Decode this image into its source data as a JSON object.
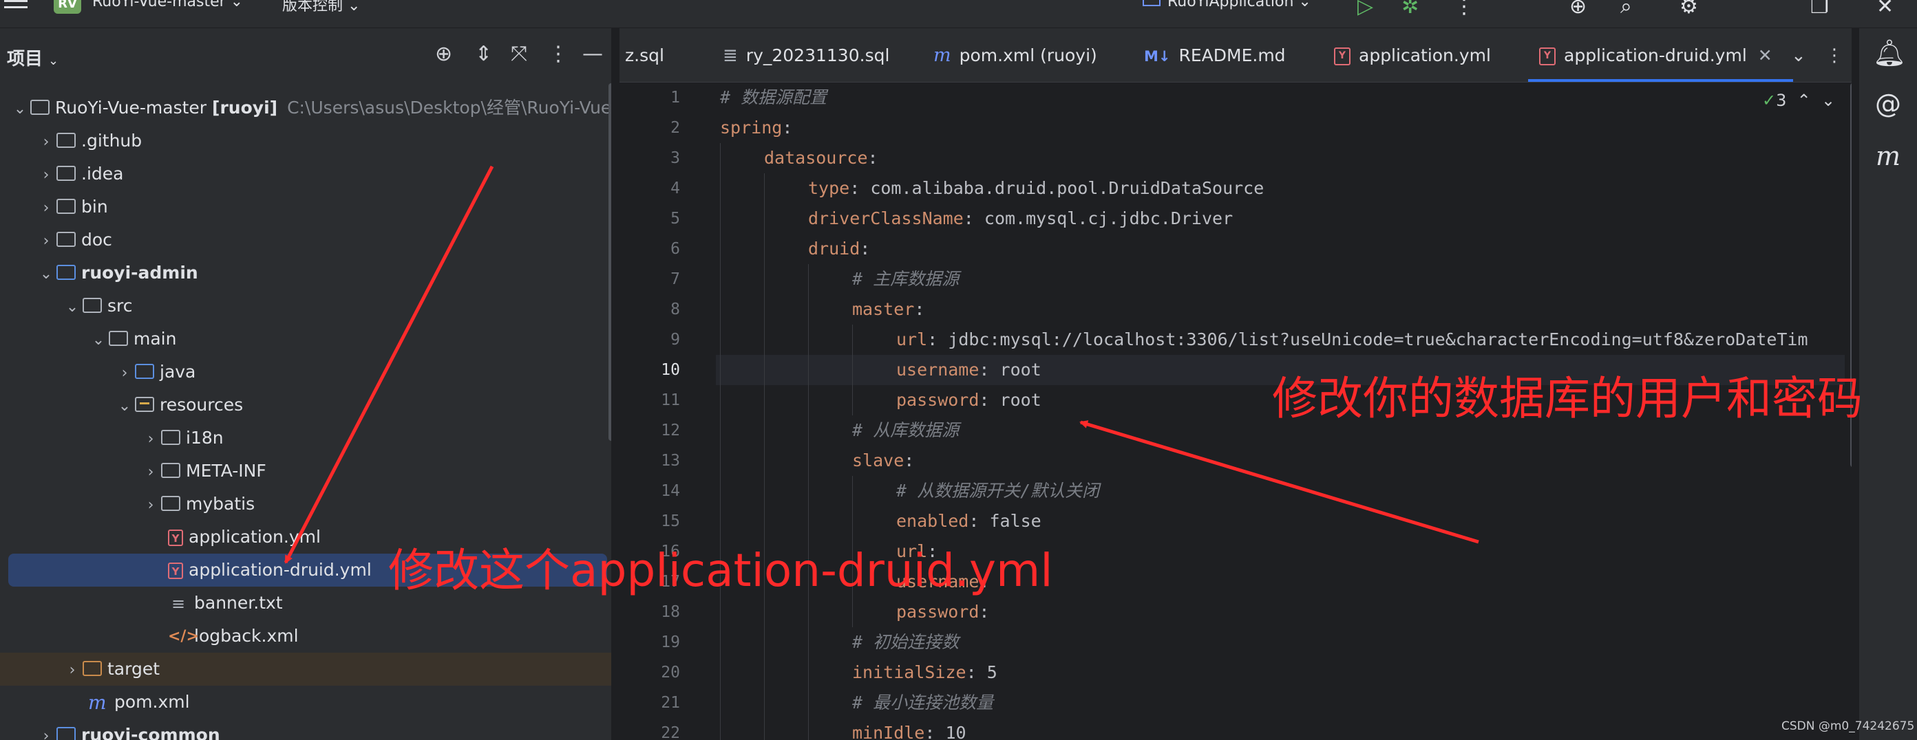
{
  "titlebar": {
    "project_badge": "RV",
    "project_name": "RuoYi-Vue-master",
    "vcs": "版本控制",
    "run_config": "RuoYiApplication"
  },
  "sidebar": {
    "title": "项目",
    "tree": [
      {
        "label": "RuoYi-Vue-master",
        "module": "[ruoyi]",
        "path": "C:\\Users\\asus\\Desktop\\经管\\RuoYi-Vue-mas"
      },
      {
        "label": ".github"
      },
      {
        "label": ".idea"
      },
      {
        "label": "bin"
      },
      {
        "label": "doc"
      },
      {
        "label": "ruoyi-admin"
      },
      {
        "label": "src"
      },
      {
        "label": "main"
      },
      {
        "label": "java"
      },
      {
        "label": "resources"
      },
      {
        "label": "i18n"
      },
      {
        "label": "META-INF"
      },
      {
        "label": "mybatis"
      },
      {
        "label": "application.yml"
      },
      {
        "label": "application-druid.yml"
      },
      {
        "label": "banner.txt"
      },
      {
        "label": "logback.xml"
      },
      {
        "label": "target"
      },
      {
        "label": "pom.xml"
      },
      {
        "label": "ruoyi-common"
      }
    ]
  },
  "tabs": [
    {
      "label": "z.sql"
    },
    {
      "label": "ry_20231130.sql"
    },
    {
      "label": "pom.xml (ruoyi)"
    },
    {
      "label": "README.md"
    },
    {
      "label": "application.yml"
    },
    {
      "label": "application-druid.yml"
    }
  ],
  "editor": {
    "inspection_count": "3",
    "current_line": 10,
    "lines": [
      {
        "n": "1",
        "comment": "# 数据源配置"
      },
      {
        "n": "2",
        "key": "spring",
        "value": ""
      },
      {
        "n": "3",
        "key": "datasource",
        "value": ""
      },
      {
        "n": "4",
        "key": "type",
        "value": " com.alibaba.druid.pool.DruidDataSource"
      },
      {
        "n": "5",
        "key": "driverClassName",
        "value": " com.mysql.cj.jdbc.Driver"
      },
      {
        "n": "6",
        "key": "druid",
        "value": ""
      },
      {
        "n": "7",
        "comment": "# 主库数据源"
      },
      {
        "n": "8",
        "key": "master",
        "value": ""
      },
      {
        "n": "9",
        "key": "url",
        "value": " jdbc:mysql://localhost:3306/list?useUnicode=true&characterEncoding=utf8&zeroDateTim"
      },
      {
        "n": "10",
        "key": "username",
        "value": " root"
      },
      {
        "n": "11",
        "key": "password",
        "value": " root"
      },
      {
        "n": "12",
        "comment": "# 从库数据源"
      },
      {
        "n": "13",
        "key": "slave",
        "value": ""
      },
      {
        "n": "14",
        "comment": "# 从数据源开关/默认关闭"
      },
      {
        "n": "15",
        "key": "enabled",
        "value": " false"
      },
      {
        "n": "16",
        "key": "url",
        "value": ""
      },
      {
        "n": "17",
        "key": "username",
        "value": ""
      },
      {
        "n": "18",
        "key": "password",
        "value": ""
      },
      {
        "n": "19",
        "comment": "# 初始连接数"
      },
      {
        "n": "20",
        "key": "initialSize",
        "value": " 5"
      },
      {
        "n": "21",
        "comment": "# 最小连接池数量"
      },
      {
        "n": "22",
        "key": "minIdle",
        "value": " 10"
      }
    ]
  },
  "annotations": {
    "edit_credentials": "修改你的数据库的用户和密码",
    "edit_file": "修改这个application-druid.yml",
    "color": "#ff2a2a"
  },
  "watermark": "CSDN @m0_74242675"
}
